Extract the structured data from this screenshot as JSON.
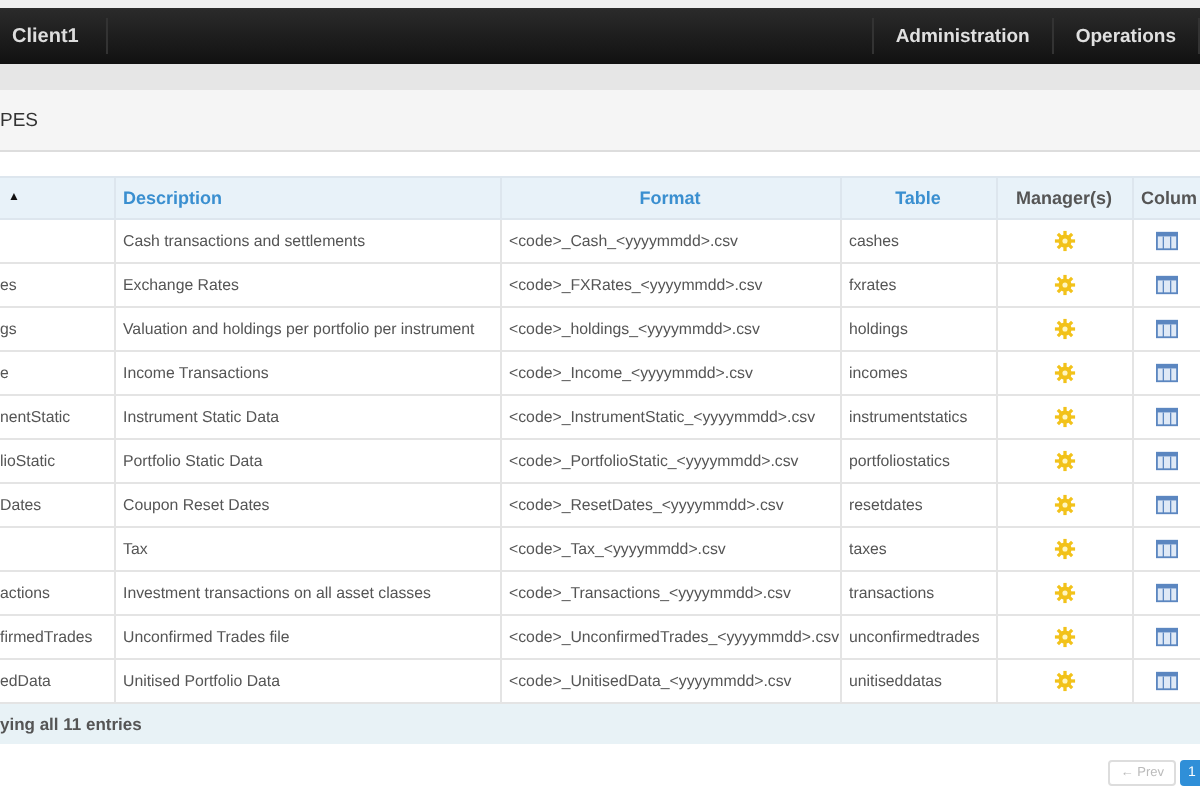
{
  "navbar": {
    "brand": "Client1",
    "items": [
      "Administration",
      "Operations"
    ]
  },
  "panel": {
    "title": "PES"
  },
  "table": {
    "columns": [
      {
        "label": "▲",
        "sortable": true
      },
      {
        "label": "Description",
        "sortable": true
      },
      {
        "label": "Format",
        "sortable": true
      },
      {
        "label": "Table",
        "sortable": true
      },
      {
        "label": "Manager(s)",
        "sortable": false
      },
      {
        "label": "Colum",
        "sortable": false
      }
    ],
    "rows": [
      {
        "name": "",
        "description": "Cash transactions and settlements",
        "format": "<code>_Cash_<yyyymmdd>.csv",
        "table": "cashes"
      },
      {
        "name": "es",
        "description": "Exchange Rates",
        "format": "<code>_FXRates_<yyyymmdd>.csv",
        "table": "fxrates"
      },
      {
        "name": "gs",
        "description": "Valuation and holdings per portfolio per instrument",
        "format": "<code>_holdings_<yyyymmdd>.csv",
        "table": "holdings"
      },
      {
        "name": "e",
        "description": "Income Transactions",
        "format": "<code>_Income_<yyyymmdd>.csv",
        "table": "incomes"
      },
      {
        "name": "nentStatic",
        "description": "Instrument Static Data",
        "format": "<code>_InstrumentStatic_<yyyymmdd>.csv",
        "table": "instrumentstatics"
      },
      {
        "name": "lioStatic",
        "description": "Portfolio Static Data",
        "format": "<code>_PortfolioStatic_<yyyymmdd>.csv",
        "table": "portfoliostatics"
      },
      {
        "name": "Dates",
        "description": "Coupon Reset Dates",
        "format": "<code>_ResetDates_<yyyymmdd>.csv",
        "table": "resetdates"
      },
      {
        "name": "",
        "description": "Tax",
        "format": "<code>_Tax_<yyyymmdd>.csv",
        "table": "taxes"
      },
      {
        "name": "actions",
        "description": "Investment transactions on all asset classes",
        "format": "<code>_Transactions_<yyyymmdd>.csv",
        "table": "transactions"
      },
      {
        "name": "firmedTrades",
        "description": "Unconfirmed Trades file",
        "format": "<code>_UnconfirmedTrades_<yyyymmdd>.csv",
        "table": "unconfirmedtrades"
      },
      {
        "name": "edData",
        "description": "Unitised Portfolio Data",
        "format": "<code>_UnitisedData_<yyyymmdd>.csv",
        "table": "unitiseddatas"
      }
    ],
    "info": "ying all 11 entries"
  },
  "pagination": {
    "prev": {
      "label": "← Prev",
      "disabled": true
    },
    "pages": [
      {
        "label": "1",
        "selected": true
      }
    ]
  }
}
